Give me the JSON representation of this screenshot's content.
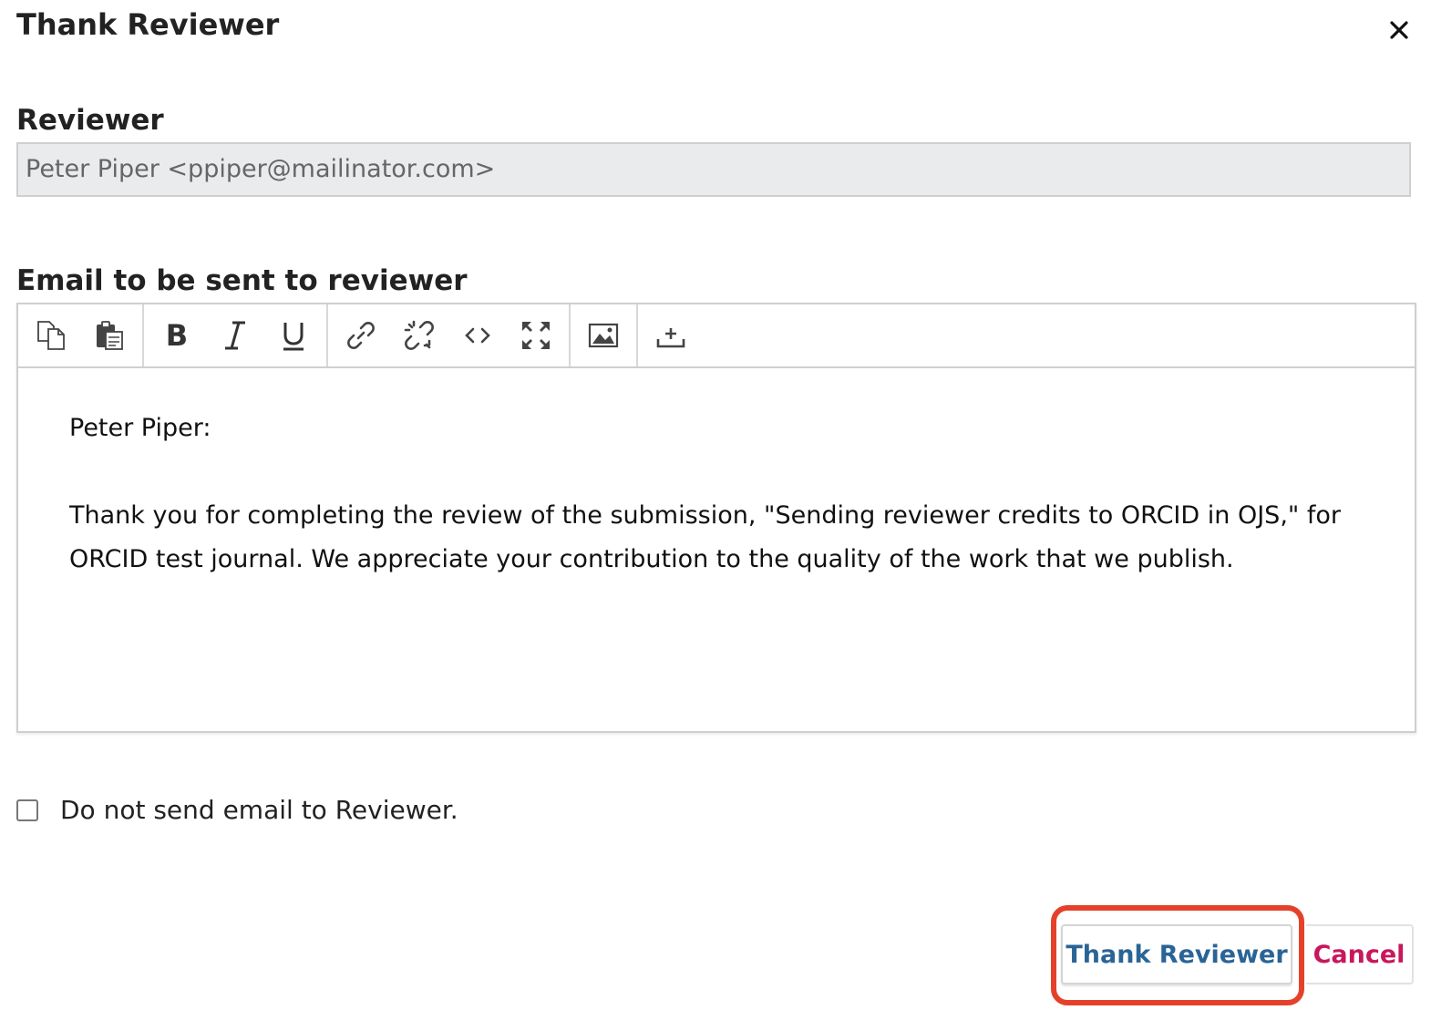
{
  "modal": {
    "title": "Thank Reviewer",
    "close_icon": "close-icon"
  },
  "reviewer": {
    "label": "Reviewer",
    "value": "Peter Piper <ppiper@mailinator.com>"
  },
  "email": {
    "label": "Email to be sent to reviewer",
    "toolbar": [
      "copy-icon",
      "paste-icon",
      "bold-icon",
      "italic-icon",
      "underline-icon",
      "link-icon",
      "unlink-icon",
      "code-icon",
      "fullscreen-icon",
      "image-icon",
      "upload-icon"
    ],
    "greeting": "Peter Piper:",
    "body": "Thank you for completing the review of the submission, \"Sending reviewer credits to ORCID in OJS,\" for ORCID test journal. We appreciate your contribution to the quality of the work that we publish."
  },
  "options": {
    "skip_email_label": "Do not send email to Reviewer.",
    "skip_email_checked": false
  },
  "actions": {
    "submit_label": "Thank Reviewer",
    "cancel_label": "Cancel",
    "submit_color": "#2a6496",
    "cancel_color": "#c8175c",
    "highlight_color": "#e5412a"
  }
}
